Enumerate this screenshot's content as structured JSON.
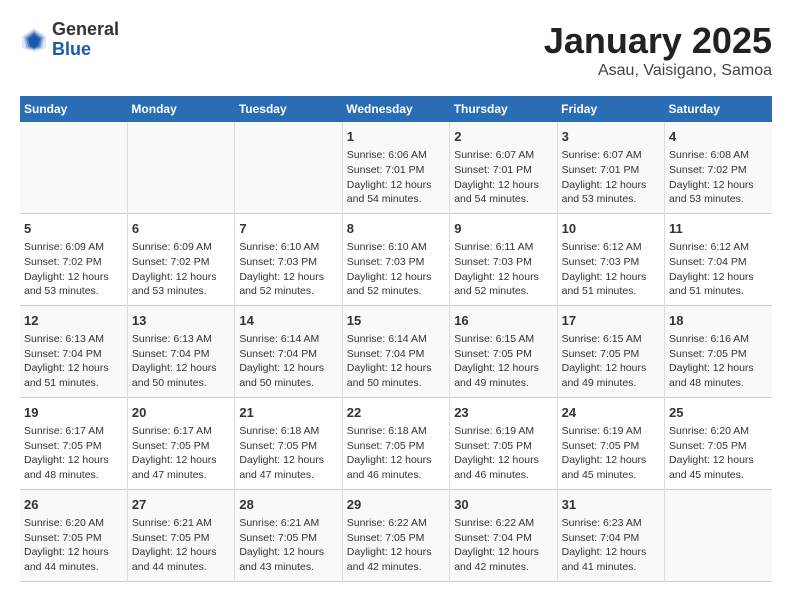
{
  "header": {
    "logo_general": "General",
    "logo_blue": "Blue",
    "title": "January 2025",
    "subtitle": "Asau, Vaisigano, Samoa"
  },
  "weekdays": [
    "Sunday",
    "Monday",
    "Tuesday",
    "Wednesday",
    "Thursday",
    "Friday",
    "Saturday"
  ],
  "weeks": [
    [
      {
        "day": "",
        "info": ""
      },
      {
        "day": "",
        "info": ""
      },
      {
        "day": "",
        "info": ""
      },
      {
        "day": "1",
        "info": "Sunrise: 6:06 AM\nSunset: 7:01 PM\nDaylight: 12 hours\nand 54 minutes."
      },
      {
        "day": "2",
        "info": "Sunrise: 6:07 AM\nSunset: 7:01 PM\nDaylight: 12 hours\nand 54 minutes."
      },
      {
        "day": "3",
        "info": "Sunrise: 6:07 AM\nSunset: 7:01 PM\nDaylight: 12 hours\nand 53 minutes."
      },
      {
        "day": "4",
        "info": "Sunrise: 6:08 AM\nSunset: 7:02 PM\nDaylight: 12 hours\nand 53 minutes."
      }
    ],
    [
      {
        "day": "5",
        "info": "Sunrise: 6:09 AM\nSunset: 7:02 PM\nDaylight: 12 hours\nand 53 minutes."
      },
      {
        "day": "6",
        "info": "Sunrise: 6:09 AM\nSunset: 7:02 PM\nDaylight: 12 hours\nand 53 minutes."
      },
      {
        "day": "7",
        "info": "Sunrise: 6:10 AM\nSunset: 7:03 PM\nDaylight: 12 hours\nand 52 minutes."
      },
      {
        "day": "8",
        "info": "Sunrise: 6:10 AM\nSunset: 7:03 PM\nDaylight: 12 hours\nand 52 minutes."
      },
      {
        "day": "9",
        "info": "Sunrise: 6:11 AM\nSunset: 7:03 PM\nDaylight: 12 hours\nand 52 minutes."
      },
      {
        "day": "10",
        "info": "Sunrise: 6:12 AM\nSunset: 7:03 PM\nDaylight: 12 hours\nand 51 minutes."
      },
      {
        "day": "11",
        "info": "Sunrise: 6:12 AM\nSunset: 7:04 PM\nDaylight: 12 hours\nand 51 minutes."
      }
    ],
    [
      {
        "day": "12",
        "info": "Sunrise: 6:13 AM\nSunset: 7:04 PM\nDaylight: 12 hours\nand 51 minutes."
      },
      {
        "day": "13",
        "info": "Sunrise: 6:13 AM\nSunset: 7:04 PM\nDaylight: 12 hours\nand 50 minutes."
      },
      {
        "day": "14",
        "info": "Sunrise: 6:14 AM\nSunset: 7:04 PM\nDaylight: 12 hours\nand 50 minutes."
      },
      {
        "day": "15",
        "info": "Sunrise: 6:14 AM\nSunset: 7:04 PM\nDaylight: 12 hours\nand 50 minutes."
      },
      {
        "day": "16",
        "info": "Sunrise: 6:15 AM\nSunset: 7:05 PM\nDaylight: 12 hours\nand 49 minutes."
      },
      {
        "day": "17",
        "info": "Sunrise: 6:15 AM\nSunset: 7:05 PM\nDaylight: 12 hours\nand 49 minutes."
      },
      {
        "day": "18",
        "info": "Sunrise: 6:16 AM\nSunset: 7:05 PM\nDaylight: 12 hours\nand 48 minutes."
      }
    ],
    [
      {
        "day": "19",
        "info": "Sunrise: 6:17 AM\nSunset: 7:05 PM\nDaylight: 12 hours\nand 48 minutes."
      },
      {
        "day": "20",
        "info": "Sunrise: 6:17 AM\nSunset: 7:05 PM\nDaylight: 12 hours\nand 47 minutes."
      },
      {
        "day": "21",
        "info": "Sunrise: 6:18 AM\nSunset: 7:05 PM\nDaylight: 12 hours\nand 47 minutes."
      },
      {
        "day": "22",
        "info": "Sunrise: 6:18 AM\nSunset: 7:05 PM\nDaylight: 12 hours\nand 46 minutes."
      },
      {
        "day": "23",
        "info": "Sunrise: 6:19 AM\nSunset: 7:05 PM\nDaylight: 12 hours\nand 46 minutes."
      },
      {
        "day": "24",
        "info": "Sunrise: 6:19 AM\nSunset: 7:05 PM\nDaylight: 12 hours\nand 45 minutes."
      },
      {
        "day": "25",
        "info": "Sunrise: 6:20 AM\nSunset: 7:05 PM\nDaylight: 12 hours\nand 45 minutes."
      }
    ],
    [
      {
        "day": "26",
        "info": "Sunrise: 6:20 AM\nSunset: 7:05 PM\nDaylight: 12 hours\nand 44 minutes."
      },
      {
        "day": "27",
        "info": "Sunrise: 6:21 AM\nSunset: 7:05 PM\nDaylight: 12 hours\nand 44 minutes."
      },
      {
        "day": "28",
        "info": "Sunrise: 6:21 AM\nSunset: 7:05 PM\nDaylight: 12 hours\nand 43 minutes."
      },
      {
        "day": "29",
        "info": "Sunrise: 6:22 AM\nSunset: 7:05 PM\nDaylight: 12 hours\nand 42 minutes."
      },
      {
        "day": "30",
        "info": "Sunrise: 6:22 AM\nSunset: 7:04 PM\nDaylight: 12 hours\nand 42 minutes."
      },
      {
        "day": "31",
        "info": "Sunrise: 6:23 AM\nSunset: 7:04 PM\nDaylight: 12 hours\nand 41 minutes."
      },
      {
        "day": "",
        "info": ""
      }
    ]
  ]
}
